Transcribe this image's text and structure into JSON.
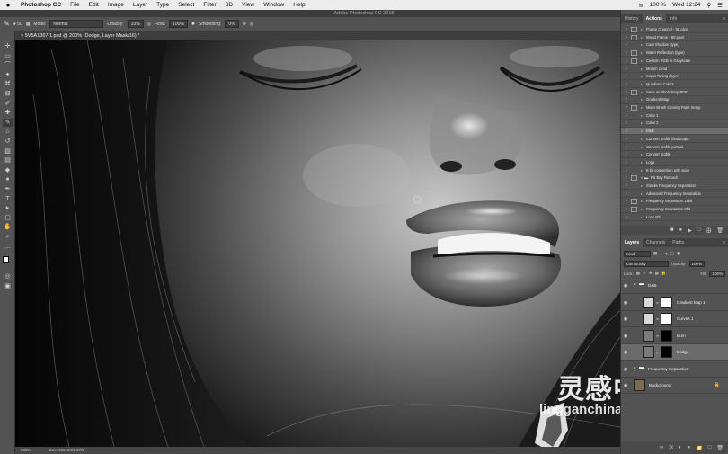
{
  "menubar": {
    "apple": "",
    "items": [
      "Photoshop CC",
      "File",
      "Edit",
      "Image",
      "Layer",
      "Type",
      "Select",
      "Filter",
      "3D",
      "View",
      "Window",
      "Help"
    ],
    "battery": "100 %",
    "clock": "Wed 12:24"
  },
  "window_title": "Adobe Photoshop CC 2018",
  "options_bar": {
    "brush_size": "50",
    "mode_label": "Mode:",
    "mode_value": "Normal",
    "opacity_label": "Opacity:",
    "opacity_value": "10%",
    "flow_label": "Flow:",
    "flow_value": "100%",
    "smoothing_label": "Smoothing:",
    "smoothing_value": "0%"
  },
  "document_tab": "5V5A1367 1.psd @ 200% (Dodge, Layer Mask/16) *",
  "status": {
    "zoom": "200%",
    "doc": "Doc: 156.4M/1.37G"
  },
  "actions_panel": {
    "tabs": [
      "History",
      "Actions",
      "Info"
    ],
    "items": [
      {
        "label": "Frame Channel - 50 pixel",
        "set": false,
        "selected": false,
        "dialog": true
      },
      {
        "label": "Wood Frame - 50 pixel",
        "set": false,
        "selected": false,
        "dialog": true
      },
      {
        "label": "Cast Shadow (type)",
        "set": false,
        "selected": false,
        "dialog": false
      },
      {
        "label": "Water Reflection (type)",
        "set": false,
        "selected": false,
        "dialog": true
      },
      {
        "label": "Custom RGB to Grayscale",
        "set": false,
        "selected": false,
        "dialog": true
      },
      {
        "label": "Molten Lead",
        "set": false,
        "selected": false,
        "dialog": false
      },
      {
        "label": "Sepia Toning (layer)",
        "set": false,
        "selected": false,
        "dialog": false
      },
      {
        "label": "Quadrant Colors",
        "set": false,
        "selected": false,
        "dialog": false
      },
      {
        "label": "Save as Photoshop PDF",
        "set": false,
        "selected": false,
        "dialog": true
      },
      {
        "label": "Gradient Map",
        "set": false,
        "selected": false,
        "dialog": false
      },
      {
        "label": "Mixer Brush Cloning Paint Setup",
        "set": false,
        "selected": false,
        "dialog": true
      },
      {
        "label": "Color 1",
        "set": false,
        "selected": false,
        "dialog": false
      },
      {
        "label": "Color 2",
        "set": false,
        "selected": false,
        "dialog": false
      },
      {
        "label": "D&B",
        "set": false,
        "selected": true,
        "dialog": false
      },
      {
        "label": "Convert profile landscape",
        "set": false,
        "selected": false,
        "dialog": false
      },
      {
        "label": "Convert profile portrait",
        "set": false,
        "selected": false,
        "dialog": false
      },
      {
        "label": "Convert profile",
        "set": false,
        "selected": false,
        "dialog": false
      },
      {
        "label": "Logo",
        "set": false,
        "selected": false,
        "dialog": false
      },
      {
        "label": "8-bit conversion with save",
        "set": false,
        "selected": false,
        "dialog": false
      },
      {
        "label": "FS Bay Retouch",
        "set": true,
        "selected": false,
        "dialog": true
      },
      {
        "label": "Simple Frequency Separation",
        "set": false,
        "selected": false,
        "dialog": false
      },
      {
        "label": "Advanced Frequency Separation",
        "set": false,
        "selected": false,
        "dialog": false
      },
      {
        "label": "Frequency Separation 16bit",
        "set": false,
        "selected": false,
        "dialog": true
      },
      {
        "label": "Frequency Separation 8bit",
        "set": false,
        "selected": false,
        "dialog": true
      },
      {
        "label": "Look B/D",
        "set": false,
        "selected": false,
        "dialog": false
      }
    ]
  },
  "layers_panel": {
    "tabs": [
      "Layers",
      "Channels",
      "Paths"
    ],
    "kind": "Kind",
    "blend": "Luminosity",
    "opacity_label": "Opacity:",
    "opacity": "100%",
    "lock_label": "Lock:",
    "fill_label": "Fill:",
    "fill": "100%",
    "layers": [
      {
        "name": "D&B",
        "type": "group",
        "selected": false,
        "thumb": "#535353",
        "mask": ""
      },
      {
        "name": "Gradient Map 1",
        "type": "adjust",
        "selected": false,
        "thumb": "#d9d9d9",
        "mask": "#ffffff"
      },
      {
        "name": "Curves 1",
        "type": "adjust",
        "selected": false,
        "thumb": "#d9d9d9",
        "mask": "#ffffff"
      },
      {
        "name": "Burn",
        "type": "pixel",
        "selected": false,
        "thumb": "#7a7a7a",
        "mask": "#000000"
      },
      {
        "name": "Dodge",
        "type": "pixel",
        "selected": true,
        "thumb": "#7a7a7a",
        "mask": "#000000"
      },
      {
        "name": "Frequency Separation",
        "type": "group",
        "selected": false,
        "thumb": "#6e5a44",
        "mask": ""
      },
      {
        "name": "Background",
        "type": "pixel",
        "selected": false,
        "thumb": "#7d6a52",
        "mask": ""
      }
    ]
  },
  "watermark": {
    "cn": "灵感中国",
    "url": "lingganchina.com"
  }
}
